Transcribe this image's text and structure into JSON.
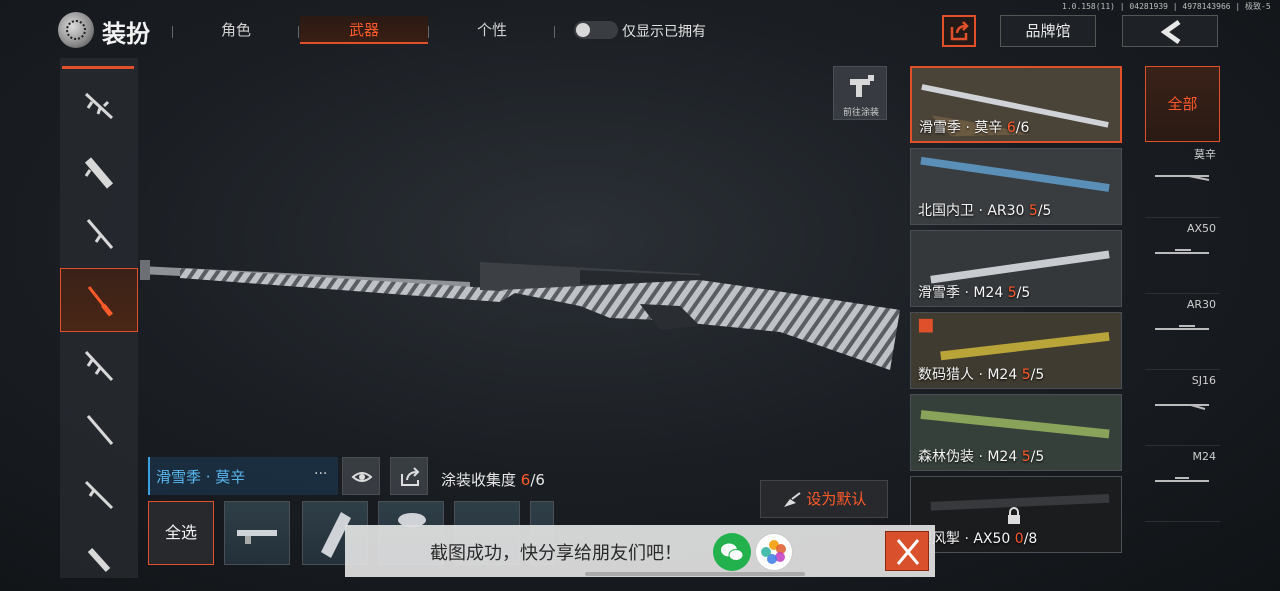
{
  "version": "1.0.158(11) | 04281939 | 4978143966 | 极致-5",
  "header": {
    "title": "装扮",
    "tabs": [
      {
        "label": "角色",
        "active": false
      },
      {
        "label": "武器",
        "active": true
      },
      {
        "label": "个性",
        "active": false
      }
    ],
    "toggle_label": "仅显示已拥有",
    "toggle_on": false,
    "brand_button": "品牌馆"
  },
  "left_weapons": [
    {
      "icon": "assault-rifle-icon",
      "active": false
    },
    {
      "icon": "smg-icon",
      "active": false
    },
    {
      "icon": "shotgun-icon",
      "active": false
    },
    {
      "icon": "sniper-rifle-icon",
      "active": true
    },
    {
      "icon": "assault-rifle-2-icon",
      "active": false
    },
    {
      "icon": "marksman-rifle-icon",
      "active": false
    },
    {
      "icon": "rifle-3-icon",
      "active": false
    },
    {
      "icon": "pistol-icon",
      "active": false
    }
  ],
  "goto_paint_label": "前往涂装",
  "selected_skin": {
    "name": "滑雪季 · 莫辛",
    "more": "···",
    "collection_label": "涂装收集度",
    "collected": "6",
    "total": "/6"
  },
  "select_all_label": "全选",
  "set_default_label": "设为默认",
  "toast": {
    "text": "截图成功，快分享给朋友们吧！"
  },
  "skins": [
    {
      "label": "滑雪季 · 莫辛 ",
      "owned": "6",
      "total": "/6",
      "active": true,
      "locked": false
    },
    {
      "label": "北国内卫 · AR30 ",
      "owned": "5",
      "total": "/5",
      "active": false,
      "locked": false
    },
    {
      "label": "滑雪季 · M24 ",
      "owned": "5",
      "total": "/5",
      "active": false,
      "locked": false
    },
    {
      "label": "数码猎人 · M24 ",
      "owned": "5",
      "total": "/5",
      "active": false,
      "locked": false
    },
    {
      "label": "森林伪装 · M24 ",
      "owned": "5",
      "total": "/5",
      "active": false,
      "locked": false
    },
    {
      "label": "婴风掣 · AX50 ",
      "owned": "0",
      "total": "/8",
      "active": false,
      "locked": true
    }
  ],
  "categories": [
    {
      "label": "全部",
      "active": true
    },
    {
      "label": "莫辛"
    },
    {
      "label": "AX50"
    },
    {
      "label": "AR30"
    },
    {
      "label": "SJ16"
    },
    {
      "label": "M24"
    }
  ],
  "colors": {
    "accent": "#e0502a",
    "skin_name_blue": "#5ab8f0"
  }
}
